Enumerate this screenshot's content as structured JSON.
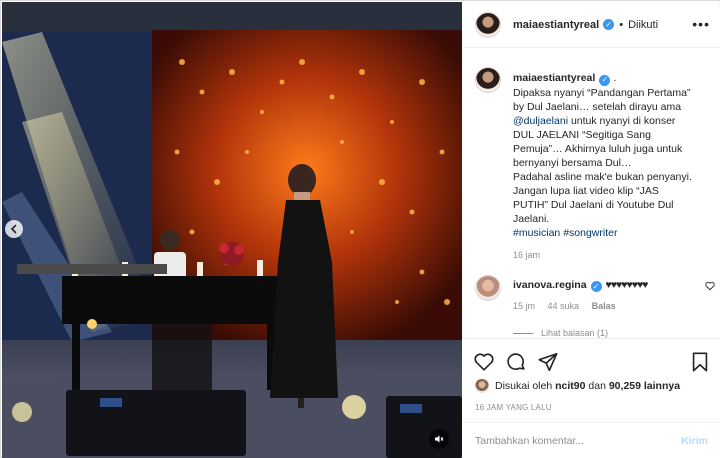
{
  "post": {
    "username": "maiaestiantyreal",
    "follow_state": "Diikuti",
    "separator": "•",
    "more_icon": "more-icon",
    "caption": {
      "username": "maiaestiantyreal",
      "suffix": ".",
      "line1": "Dipaksa nyanyi “Pandangan Pertama”",
      "line2": "by Dul Jaelani… setelah dirayu ama",
      "mention": "@duljaelani",
      "line3_rest": " untuk nyanyi di konser",
      "line4": "DUL JAELANI “Segitiga Sang",
      "line5": "Pemuja”… Akhirnya luluh juga untuk",
      "line6": "bernyanyi bersama Dul…",
      "line7": "Padahal asline mak'e bukan penyanyi.",
      "line8": "Jangan lupa liat video klip “JAS",
      "line9": "PUTIH” Dul Jaelani di Youtube Dul",
      "line10": "Jaelani.",
      "hashtags": "#musician #songwriter",
      "time": "16 jam"
    },
    "comment": {
      "username": "ivanova.regina",
      "text": "♥♥♥♥♥♥♥♥",
      "time": "15 jm",
      "likes": "44 suka",
      "reply_label": "Balas"
    },
    "view_replies": "Lihat balasan (1)",
    "liked_by": {
      "prefix": "Disukai oleh ",
      "user": "ncit90",
      "middle": " dan ",
      "count": "90,259 lainnya"
    },
    "posted_ago": "16 JAM YANG LALU",
    "add_comment": {
      "placeholder": "Tambahkan komentar...",
      "submit_label": "Kirim"
    }
  },
  "colors": {
    "verified_blue": "#3897f0",
    "link_blue": "#00376b",
    "muted_gray": "#8e8e8e",
    "post_button_disabled": "#b2dffc"
  },
  "icons": [
    "chevron-left-icon",
    "volume-mute-icon",
    "more-icon",
    "verified-icon",
    "heart-icon",
    "comment-icon",
    "share-icon",
    "bookmark-icon"
  ]
}
